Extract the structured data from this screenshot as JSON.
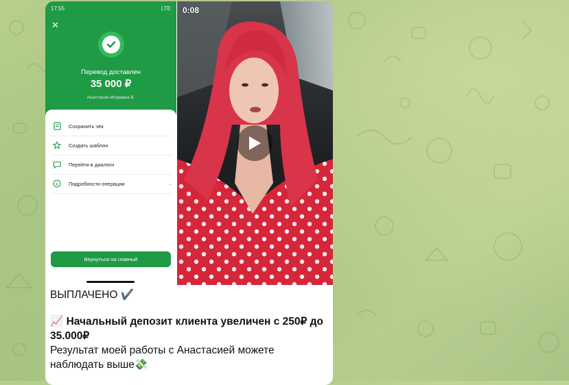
{
  "phone": {
    "time": "17:55",
    "network": "LTE",
    "transfer_title": "Перевод доставлен",
    "amount": "35 000 ₽",
    "recipient": "Анастасия Игоревна В.",
    "actions": [
      {
        "label": "Сохранить чек",
        "icon": "receipt-icon"
      },
      {
        "label": "Создать шаблон",
        "icon": "star-icon"
      },
      {
        "label": "Перейти в диалоги",
        "icon": "chat-icon"
      },
      {
        "label": "Подробности операции",
        "icon": "info-icon"
      }
    ],
    "home_button": "Вернуться на главный"
  },
  "video": {
    "duration": "0:08"
  },
  "message": {
    "line1": "ВЫПЛАЧЕНО ✔️",
    "line2": "📈 Начальный депозит клиента увеличен с 250₽ до 35.000₽",
    "line3": "Результат моей работы с Анастасией можете наблюдать выше💸"
  },
  "colors": {
    "bank_green": "#1f9a45",
    "hair": "#d8344a",
    "dress": "#d6263a"
  }
}
